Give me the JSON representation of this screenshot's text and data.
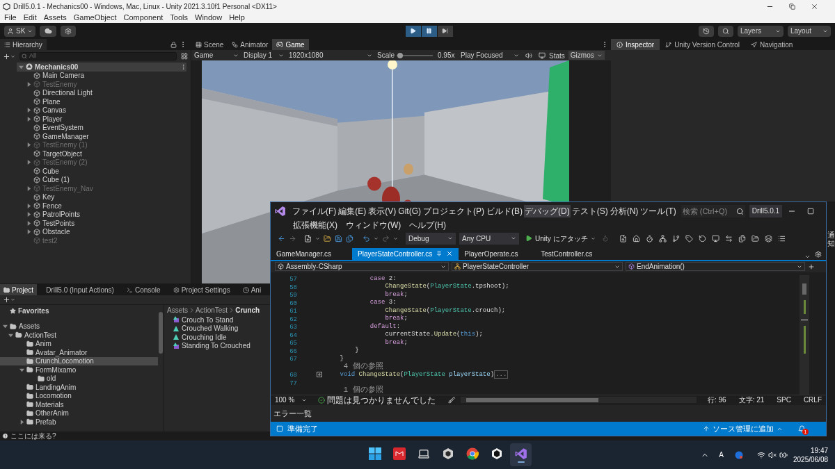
{
  "window": {
    "title": "Drill5.0.1 - Mechanics00 - Windows, Mac, Linux - Unity 2021.3.10f1 Personal <DX11>"
  },
  "menu": [
    "File",
    "Edit",
    "Assets",
    "GameObject",
    "Component",
    "Tools",
    "Window",
    "Help"
  ],
  "toolbar": {
    "account": "SK",
    "play": [
      {
        "kind": "play",
        "on": true
      },
      {
        "kind": "pause",
        "on": true
      },
      {
        "kind": "step",
        "on": false
      }
    ],
    "layers": "Layers",
    "layout": "Layout"
  },
  "hierarchy": {
    "tab": "Hierarchy",
    "search": {
      "placeholder": "All"
    },
    "root": {
      "name": "Mechanics00",
      "expanded": true,
      "children": [
        {
          "name": "Main Camera",
          "active": true
        },
        {
          "name": "TestEnemy",
          "active": false,
          "expanded": false
        },
        {
          "name": "Directional Light",
          "active": true
        },
        {
          "name": "Plane",
          "active": true
        },
        {
          "name": "Canvas",
          "active": true,
          "expanded": false
        },
        {
          "name": "Player",
          "active": true,
          "expanded": false
        },
        {
          "name": "EventSystem",
          "active": true
        },
        {
          "name": "GameManager",
          "active": true
        },
        {
          "name": "TestEnemy (1)",
          "active": false,
          "expanded": false
        },
        {
          "name": "TargetObject",
          "active": true
        },
        {
          "name": "TestEnemy (2)",
          "active": false,
          "expanded": false
        },
        {
          "name": "Cube",
          "active": true
        },
        {
          "name": "Cube (1)",
          "active": true
        },
        {
          "name": "TestEnemy_Nav",
          "active": false,
          "expanded": false
        },
        {
          "name": "Key",
          "active": true
        },
        {
          "name": "Fence",
          "active": true,
          "expanded": false
        },
        {
          "name": "PatrolPoints",
          "active": true,
          "expanded": false
        },
        {
          "name": "TestPoints",
          "active": true,
          "expanded": false
        },
        {
          "name": "Obstacle",
          "active": true,
          "expanded": false
        },
        {
          "name": "test2",
          "active": false
        }
      ]
    }
  },
  "scene_tabs": [
    {
      "label": "Scene",
      "kind": "scene",
      "selected": false
    },
    {
      "label": "Animator",
      "kind": "animator",
      "selected": false
    },
    {
      "label": "Game",
      "kind": "game",
      "selected": true
    }
  ],
  "game_bar": {
    "view": "Game",
    "display": "Display 1",
    "resolution": "1920x1080",
    "scale_label": "Scale",
    "scale": {
      "level": 0.1
    },
    "scale_value": "0.95x",
    "play_mode": "Play Focused",
    "stats": "Stats",
    "gizmos": "Gizmos"
  },
  "inspector_tabs": [
    {
      "label": "Inspector",
      "kind": "info",
      "selected": true
    },
    {
      "label": "Unity Version Control",
      "kind": "vcs",
      "selected": false
    },
    {
      "label": "Navigation",
      "kind": "nav",
      "selected": false
    }
  ],
  "project": {
    "tabs": [
      {
        "label": "Project",
        "kind": "folder",
        "selected": true
      },
      {
        "label": "Drill5.0 (Input Actions)",
        "kind": "plain",
        "selected": false
      },
      {
        "label": "Console",
        "kind": "console",
        "selected": false
      },
      {
        "label": "Project Settings",
        "kind": "gear",
        "selected": false
      },
      {
        "label": "Ani",
        "kind": "clock",
        "selected": false
      }
    ],
    "favorites": "Favorites",
    "tree": [
      {
        "name": "Assets",
        "selected": false,
        "expanded": true,
        "children": [
          {
            "name": "ActionTest",
            "selected": false,
            "expanded": true,
            "children": [
              {
                "name": "Anim",
                "selected": false
              },
              {
                "name": "Avatar_Animator",
                "selected": false
              },
              {
                "name": "CrunchLocomotion",
                "selected": true
              },
              {
                "name": "FormMixamo",
                "selected": false,
                "expanded": true,
                "children": [
                  {
                    "name": "old",
                    "selected": false
                  }
                ]
              },
              {
                "name": "LandingAnim",
                "selected": false
              },
              {
                "name": "Locomotion",
                "selected": false
              },
              {
                "name": "Materials",
                "selected": false
              },
              {
                "name": "OtherAnim",
                "selected": false
              },
              {
                "name": "Prefab",
                "selected": false,
                "expanded": false
              }
            ]
          }
        ]
      }
    ],
    "breadcrumb": [
      "Assets",
      "ActionTest",
      "Crunch"
    ],
    "files": [
      {
        "name": "Crouch To Stand",
        "kind": "clip"
      },
      {
        "name": "Crouched Walking",
        "kind": "model"
      },
      {
        "name": "Crouching Idle",
        "kind": "model"
      },
      {
        "name": "Standing To Crouched",
        "kind": "clip"
      }
    ]
  },
  "status": {
    "message": "ここには来る?"
  },
  "vs": {
    "menu_rows": [
      [
        {
          "label": "ファイル(F)",
          "selected": false
        },
        {
          "label": "編集(E)",
          "selected": false
        },
        {
          "label": "表示(V)",
          "selected": false
        },
        {
          "label": "Git(G)",
          "selected": false
        },
        {
          "label": "プロジェクト(P)",
          "selected": false
        },
        {
          "label": "ビルド(B)",
          "selected": false
        },
        {
          "label": "デバッグ(D)",
          "selected": true
        },
        {
          "label": "テスト(S)",
          "selected": false
        },
        {
          "label": "分析(N)",
          "selected": false
        },
        {
          "label": "ツール(T)",
          "selected": false
        }
      ],
      [
        {
          "label": "拡張機能(X)",
          "selected": false
        },
        {
          "label": "ウィンドウ(W)",
          "selected": false
        },
        {
          "label": "ヘルプ(H)",
          "selected": false
        }
      ]
    ],
    "search": {
      "placeholder": "検索 (Ctrl+Q)"
    },
    "solution": "Drill5.0.1",
    "config": "Debug",
    "platform": "Any CPU",
    "attach": "Unity にアタッチ",
    "side_label": "通知",
    "tabs": [
      {
        "label": "GameManager.cs",
        "selected": false
      },
      {
        "label": "PlayerStateController.cs",
        "selected": true
      },
      {
        "label": "PlayerOperate.cs",
        "selected": false
      },
      {
        "label": "TestController.cs",
        "selected": false
      }
    ],
    "nav": [
      {
        "label": "Assembly-CSharp",
        "kind": "project"
      },
      {
        "label": "PlayerStateController",
        "kind": "class"
      },
      {
        "label": "EndAnimation()",
        "kind": "method"
      }
    ],
    "code": [
      {
        "number": "57",
        "folded": false,
        "tokens": [
          {
            "text": "            case",
            "kind": "keyword"
          },
          {
            "text": " 2:",
            "kind": "plain"
          }
        ]
      },
      {
        "number": "58",
        "folded": false,
        "tokens": [
          {
            "text": "                ChangeState",
            "kind": "method"
          },
          {
            "text": "(",
            "kind": "plain"
          },
          {
            "text": "PlayerState",
            "kind": "type"
          },
          {
            "text": ".tpshoot);",
            "kind": "plain"
          }
        ]
      },
      {
        "number": "59",
        "folded": false,
        "tokens": [
          {
            "text": "                break",
            "kind": "keyword"
          },
          {
            "text": ";",
            "kind": "plain"
          }
        ]
      },
      {
        "number": "60",
        "folded": false,
        "tokens": [
          {
            "text": "            case",
            "kind": "keyword"
          },
          {
            "text": " 3:",
            "kind": "plain"
          }
        ]
      },
      {
        "number": "61",
        "folded": false,
        "tokens": [
          {
            "text": "                ChangeState",
            "kind": "method"
          },
          {
            "text": "(",
            "kind": "plain"
          },
          {
            "text": "PlayerState",
            "kind": "type"
          },
          {
            "text": ".crouch);",
            "kind": "plain"
          }
        ]
      },
      {
        "number": "62",
        "folded": false,
        "tokens": [
          {
            "text": "                break",
            "kind": "keyword"
          },
          {
            "text": ";",
            "kind": "plain"
          }
        ]
      },
      {
        "number": "63",
        "folded": false,
        "tokens": [
          {
            "text": "            default",
            "kind": "keyword"
          },
          {
            "text": ":",
            "kind": "plain"
          }
        ]
      },
      {
        "number": "64",
        "folded": false,
        "tokens": [
          {
            "text": "                currentState.",
            "kind": "plain"
          },
          {
            "text": "Update",
            "kind": "method"
          },
          {
            "text": "(",
            "kind": "plain"
          },
          {
            "text": "this",
            "kind": "kw"
          },
          {
            "text": ");",
            "kind": "plain"
          }
        ]
      },
      {
        "number": "65",
        "folded": false,
        "tokens": [
          {
            "text": "                break",
            "kind": "keyword"
          },
          {
            "text": ";",
            "kind": "plain"
          }
        ]
      },
      {
        "number": "66",
        "folded": false,
        "tokens": [
          {
            "text": "        }",
            "kind": "plain"
          }
        ]
      },
      {
        "number": "67",
        "folded": false,
        "tokens": [
          {
            "text": "    }",
            "kind": "plain"
          }
        ]
      },
      {
        "folded": false,
        "tokens": [
          {
            "text": "    4 個の参照",
            "kind": "refs"
          }
        ]
      },
      {
        "number": "68",
        "folded": true,
        "tokens": [
          {
            "text": "    void",
            "kind": "kw"
          },
          {
            "text": " ChangeState",
            "kind": "method"
          },
          {
            "text": "(",
            "kind": "plain"
          },
          {
            "text": "PlayerState",
            "kind": "type"
          },
          {
            "text": " playerState",
            "kind": "param"
          },
          {
            "text": ")",
            "kind": "plain"
          },
          {
            "text": "...",
            "kind": "ellipsis"
          }
        ]
      },
      {
        "number": "77",
        "folded": false
      },
      {
        "folded": false,
        "tokens": [
          {
            "text": "    1 個の参照",
            "kind": "refs"
          }
        ]
      }
    ],
    "zoom": "100 %",
    "issues": "問題は見つかりませんでした",
    "line": "行: 96",
    "column": "文字: 21",
    "spacing": "SPC",
    "eol": "CRLF",
    "error_list": "エラー一覧",
    "status": "準備完了",
    "source_control": "ソース管理に追加",
    "notifications": "1"
  },
  "taskbar": {
    "apps": [
      {
        "kind": "start",
        "selected": false
      },
      {
        "kind": "calendar",
        "selected": false
      },
      {
        "kind": "laptop",
        "selected": false
      },
      {
        "kind": "unity",
        "selected": false
      },
      {
        "kind": "browser",
        "selected": false
      },
      {
        "kind": "unity-dark",
        "selected": false
      },
      {
        "kind": "vs",
        "selected": true
      }
    ],
    "ime": "A",
    "time": "19:47",
    "date": "2025/06/08"
  }
}
